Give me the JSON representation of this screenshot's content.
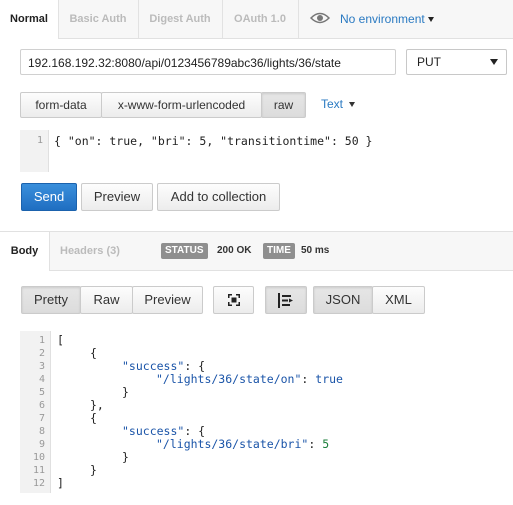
{
  "auth_tabs": [
    "Normal",
    "Basic Auth",
    "Digest Auth",
    "OAuth 1.0"
  ],
  "environment": "No environment",
  "request": {
    "url": "192.168.192.32:8080/api/0123456789abc36/lights/36/state",
    "method": "PUT"
  },
  "body_types": [
    "form-data",
    "x-www-form-urlencoded",
    "raw"
  ],
  "text_type": "Text",
  "request_body": {
    "line_numbers": [
      "1"
    ],
    "line": "{ \"on\": true, \"bri\": 5, \"transitiontime\": 50 }"
  },
  "actions": {
    "send": "Send",
    "preview": "Preview",
    "add_to_collection": "Add to collection"
  },
  "response_tabs": [
    "Body",
    "Headers (3)"
  ],
  "status": {
    "label": "STATUS",
    "value": "200 OK"
  },
  "time": {
    "label": "TIME",
    "value": "50 ms"
  },
  "view_modes": [
    "Pretty",
    "Raw",
    "Preview"
  ],
  "format_modes": [
    "JSON",
    "XML"
  ],
  "icons": {
    "environment": "eye-icon",
    "fullscreen": "fullscreen-icon",
    "wrap": "wrap-lines-icon"
  },
  "response_body": {
    "line_numbers": [
      "1",
      "2",
      "3",
      "4",
      "5",
      "6",
      "7",
      "8",
      "9",
      "10",
      "11",
      "12"
    ],
    "lines": {
      "l1": "[",
      "l2": "{",
      "l3_key": "\"success\"",
      "l3_rest": ": {",
      "l4_key": "\"/lights/36/state/on\"",
      "l4_sep": ": ",
      "l4_val": "true",
      "l5": "}",
      "l6": "},",
      "l7": "{",
      "l8_key": "\"success\"",
      "l8_rest": ": {",
      "l9_key": "\"/lights/36/state/bri\"",
      "l9_sep": ": ",
      "l9_val": "5",
      "l10": "}",
      "l11": "}",
      "l12": "]"
    }
  },
  "colors": {
    "accent": "#2a7ac2",
    "send_button": "#2a78cc",
    "badge": "#8f8f8f"
  }
}
